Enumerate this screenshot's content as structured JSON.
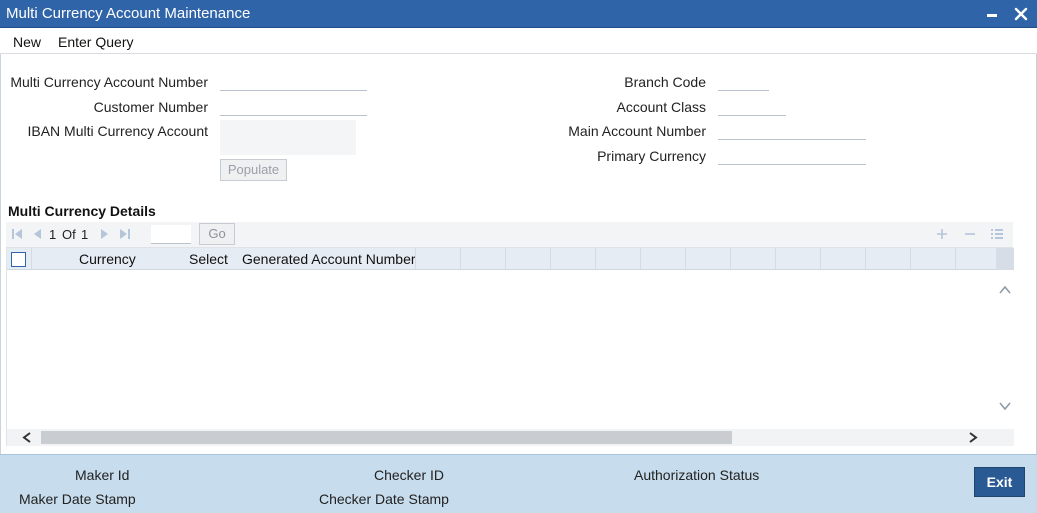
{
  "window": {
    "title": "Multi Currency Account Maintenance",
    "minimize_icon": "minimize-icon",
    "close_icon": "close-icon"
  },
  "toolbar": {
    "new_label": "New",
    "enter_query_label": "Enter Query"
  },
  "form": {
    "mc_account_number_label": "Multi Currency Account Number",
    "mc_account_number_value": "",
    "customer_number_label": "Customer Number",
    "customer_number_value": "",
    "iban_label": "IBAN Multi Currency Account",
    "iban_value": "",
    "populate_label": "Populate",
    "branch_code_label": "Branch Code",
    "branch_code_value": "",
    "account_class_label": "Account Class",
    "account_class_value": "",
    "main_account_number_label": "Main Account Number",
    "main_account_number_value": "",
    "primary_currency_label": "Primary Currency",
    "primary_currency_value": ""
  },
  "details": {
    "section_title": "Multi Currency Details",
    "pagination": {
      "current_page": "1",
      "of_label": "Of",
      "total_pages": "1",
      "go_label": "Go"
    },
    "columns": [
      "Currency",
      "Select",
      "Generated Account Number"
    ],
    "rows": []
  },
  "footer": {
    "maker_id_label": "Maker Id",
    "maker_date_stamp_label": "Maker Date Stamp",
    "checker_id_label": "Checker ID",
    "checker_date_stamp_label": "Checker Date Stamp",
    "authorization_status_label": "Authorization Status",
    "exit_label": "Exit"
  },
  "colors": {
    "titlebar": "#2f64a8",
    "footer": "#c7dcec",
    "exit_button": "#2a5a93",
    "grid_header": "#e6ecf3"
  }
}
